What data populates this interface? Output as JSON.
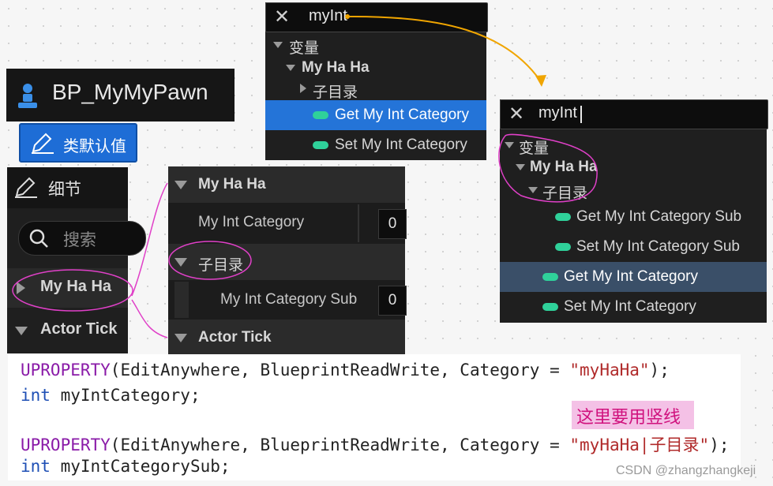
{
  "title_bar": {
    "name": "BP_MyMyPawn",
    "icon": "pawn-icon"
  },
  "class_defaults": {
    "label": "类默认值",
    "icon": "pencil-icon"
  },
  "details": {
    "title": "细节",
    "search_placeholder": "搜索",
    "categories": [
      {
        "label": "My Ha Ha"
      },
      {
        "label": "Actor Tick"
      }
    ]
  },
  "mid_panel": {
    "rows": [
      {
        "label": "My Ha Ha"
      },
      {
        "label": "My Int Category",
        "value": "0"
      },
      {
        "label": "子目录"
      },
      {
        "label": "My Int Category Sub",
        "value": "0"
      },
      {
        "label": "Actor Tick"
      }
    ]
  },
  "popup1": {
    "query": "myInt",
    "rows": [
      "变量",
      "My Ha Ha",
      "子目录",
      "Get My Int Category",
      "Set My Int Category"
    ]
  },
  "popup2": {
    "query": "myInt",
    "rows": [
      "变量",
      "My Ha Ha",
      "子目录",
      "Get My Int Category Sub",
      "Set My Int Category Sub",
      "Get My Int Category",
      "Set My Int Category"
    ]
  },
  "code": {
    "l1_macro": "UPROPERTY",
    "l1_args": "(EditAnywhere, BlueprintReadWrite, Category = ",
    "l1_str": "\"myHaHa\"",
    "l1_end": ");",
    "l2_type": "int",
    "l2_rest": " myIntCategory;",
    "l3_macro": "UPROPERTY",
    "l3_args": "(EditAnywhere, BlueprintReadWrite, Category = ",
    "l3_str": "\"myHaHa|子目录\"",
    "l3_end": ");",
    "l4_type": "int",
    "l4_rest": " myIntCategorySub;"
  },
  "note": "这里要用竖线",
  "watermark": "CSDN @zhangzhangkeji",
  "colors": {
    "accent_blue": "#1e6dd6",
    "selected": "#2474d8",
    "pill": "#2fd19a",
    "annot": "#e040c8",
    "arrow": "#f0a500"
  }
}
